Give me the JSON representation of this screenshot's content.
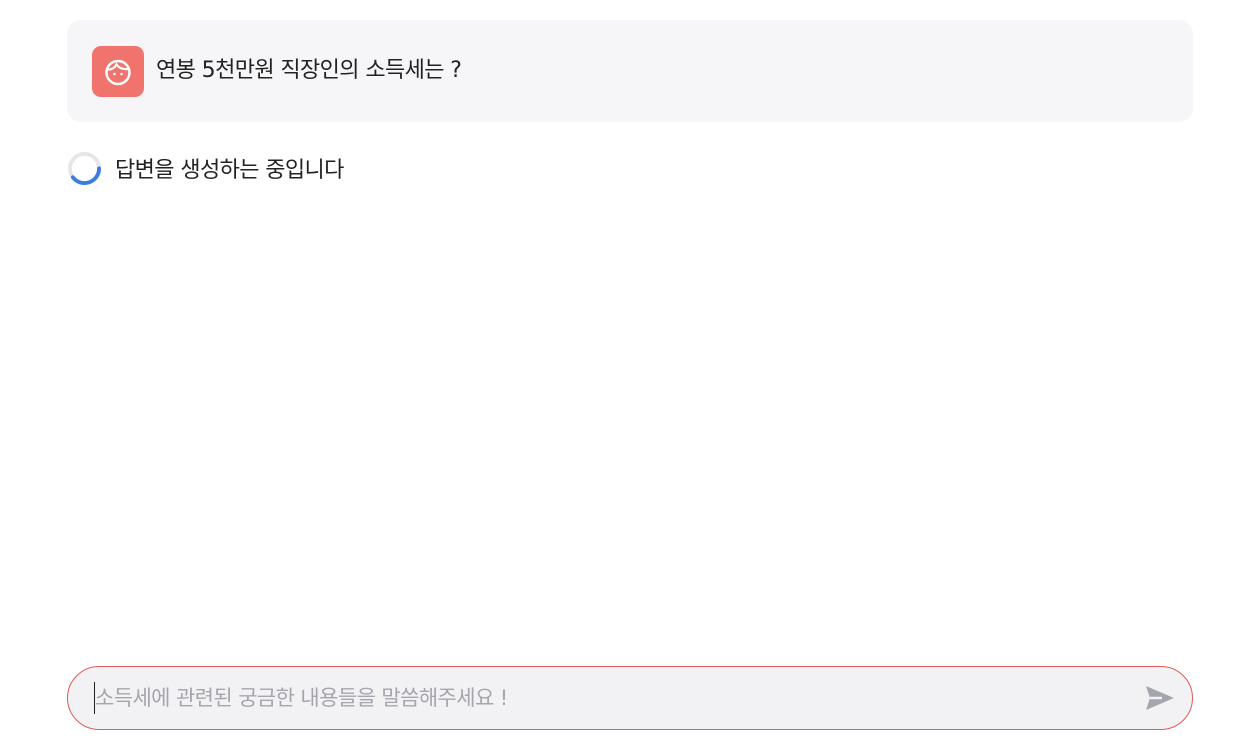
{
  "conversation": {
    "question": "연봉 5천만원 직장인의 소득세는 ?",
    "avatar_icon": "face-icon",
    "avatar_color": "#f0736d",
    "loading_text": "답변을 생성하는 중입니다",
    "loading_icon": "spinner-icon",
    "spinner_accent": "#3b7ddd"
  },
  "input_bar": {
    "placeholder": "소득세에 관련된 궁금한 내용들을 말씀해주세요 !",
    "value": "",
    "send_icon": "send-icon",
    "border_color": "#e35a5a"
  }
}
